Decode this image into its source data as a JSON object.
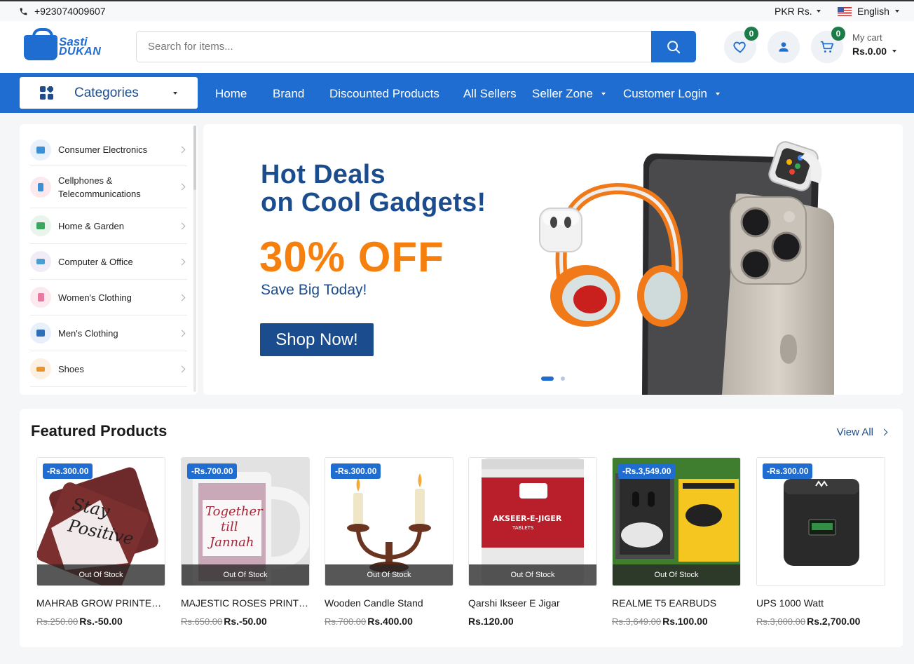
{
  "topbar": {
    "phone": "+923074009607",
    "currency": "PKR Rs.",
    "language": "English"
  },
  "header": {
    "logo_line1": "Sasti",
    "logo_line2": "DUKAN",
    "search_placeholder": "Search for items...",
    "wishlist_count": "0",
    "cart_count": "0",
    "cart_label": "My cart",
    "cart_total": "Rs.0.00"
  },
  "nav": {
    "categories_label": "Categories",
    "items": [
      "Home",
      "Brand",
      "Discounted Products",
      "All Sellers",
      "Seller Zone",
      "Customer Login"
    ]
  },
  "sidebar": {
    "categories": [
      {
        "label": "Consumer Electronics",
        "icon": "monitor-icon",
        "color": "#3d8fd6"
      },
      {
        "label": "Cellphones & Telecommunications",
        "icon": "phone-icon",
        "color": "#3d8fd6"
      },
      {
        "label": "Home & Garden",
        "icon": "house-icon",
        "color": "#3aa660"
      },
      {
        "label": "Computer & Office",
        "icon": "laptop-icon",
        "color": "#4a9fd1"
      },
      {
        "label": "Women's Clothing",
        "icon": "dress-icon",
        "color": "#e67aa3"
      },
      {
        "label": "Men's Clothing",
        "icon": "tshirt-icon",
        "color": "#2e6fb8"
      },
      {
        "label": "Shoes",
        "icon": "shoe-icon",
        "color": "#e8952f"
      }
    ]
  },
  "banner": {
    "headline_1": "Hot Deals",
    "headline_2": "on Cool Gadgets!",
    "offer": "30% OFF",
    "subline": "Save Big Today!",
    "cta": "Shop Now!"
  },
  "featured": {
    "title": "Featured Products",
    "view_all": "View All",
    "products": [
      {
        "name": "MAHRAB GROW PRINTED...",
        "discount": "-Rs.300.00",
        "old_price": "Rs.250.00",
        "price": "Rs.-50.00",
        "stock": "Out Of Stock"
      },
      {
        "name": "MAJESTIC ROSES PRINTED...",
        "discount": "-Rs.700.00",
        "old_price": "Rs.650.00",
        "price": "Rs.-50.00",
        "stock": "Out Of Stock"
      },
      {
        "name": "Wooden Candle Stand",
        "discount": "-Rs.300.00",
        "old_price": "Rs.700.00",
        "price": "Rs.400.00",
        "stock": "Out Of Stock"
      },
      {
        "name": "Qarshi Ikseer E Jigar",
        "discount": "",
        "old_price": "",
        "price": "Rs.120.00",
        "stock": "Out Of Stock"
      },
      {
        "name": "REALME T5 EARBUDS",
        "discount": "-Rs.3,549.00",
        "old_price": "Rs.3,649.00",
        "price": "Rs.100.00",
        "stock": "Out Of Stock"
      },
      {
        "name": "UPS 1000 Watt",
        "discount": "-Rs.300.00",
        "old_price": "Rs.3,000.00",
        "price": "Rs.2,700.00",
        "stock": ""
      }
    ]
  },
  "colors": {
    "brand": "#1f6dd0",
    "offer": "#f5800e",
    "heading": "#1b4d8e",
    "badge": "#1b7c4a"
  }
}
